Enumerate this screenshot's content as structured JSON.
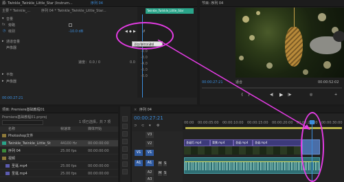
{
  "effect_controls": {
    "tabs": [
      "源: Twinkle_Twinkle_Little_Star (Instrum...",
      "序列 04"
    ],
    "breadcrumb_left": "主要 * Twinkle_...",
    "breadcrumb_right": "序列 04 * Twinkle_Twinkle_Little_Star...",
    "clip_label": "Twinkle_Twinkle_Little_Star",
    "section_audio": "音量",
    "prop_bypass": "旁路",
    "prop_level": "级别",
    "level_value": "-10.0 dB",
    "prop_channel": "通道音量",
    "prop_panner": "声像器",
    "panner_value": "0.0",
    "prop_balance": "平衡",
    "balance_value": "0.0 / 0",
    "db_ticks": [
      "-2.0",
      "-3.0",
      "-4.0",
      "-5.0",
      "-6.0"
    ],
    "tooltip": "添加/移除关键帧",
    "timecode": "00:00:27:21"
  },
  "program_monitor": {
    "title": "节目: 序列 04",
    "timecode": "00:00:27:21",
    "fit": "适合",
    "duration": "00:00:52:02"
  },
  "project": {
    "title": "项目: Premiere基础教程01",
    "file": "Premiere基础教程01.prproj",
    "columns": [
      "名称",
      "帧速率",
      "媒体开始"
    ],
    "selected_count": "1 项已选择，共 7 项",
    "items": [
      {
        "name": "Photoshop文件",
        "rate": "",
        "start": ""
      },
      {
        "name": "Twinkle_Twinkle_Little_St",
        "rate": "44100 Hz",
        "start": "00:00:00:00"
      },
      {
        "name": "序列 04",
        "rate": "25.00 fps",
        "start": "00:00:00:00"
      },
      {
        "name": "视频",
        "rate": "",
        "start": ""
      },
      {
        "name": "圣诞.mp4",
        "rate": "25.00 fps",
        "start": "00:00:00:00"
      },
      {
        "name": "圣诞.mp4",
        "rate": "25.00 fps",
        "start": "00:00:00:00"
      }
    ]
  },
  "timeline": {
    "title": "序列 04",
    "timecode": "00:00:27:21",
    "ruler": [
      "00:00",
      "00:00:05:00",
      "00:00:10:00",
      "00:00:15:00",
      "00:00:20:00",
      "00:00:25:00",
      "00:00:30:00"
    ],
    "tracks": [
      "V3",
      "V2",
      "V1",
      "A1",
      "A2",
      "A3"
    ],
    "source_tracks": [
      "V1",
      "A1"
    ],
    "clips_v": [
      "圣诞灯.mp4",
      "背景.mp4",
      "圣诞.mp4",
      "圣诞.mp4"
    ]
  },
  "colors": {
    "accent": "#3b8fe0",
    "highlight": "#e63ce6",
    "clip_video": "#3c3a7a",
    "clip_audio": "#2e6e73"
  }
}
